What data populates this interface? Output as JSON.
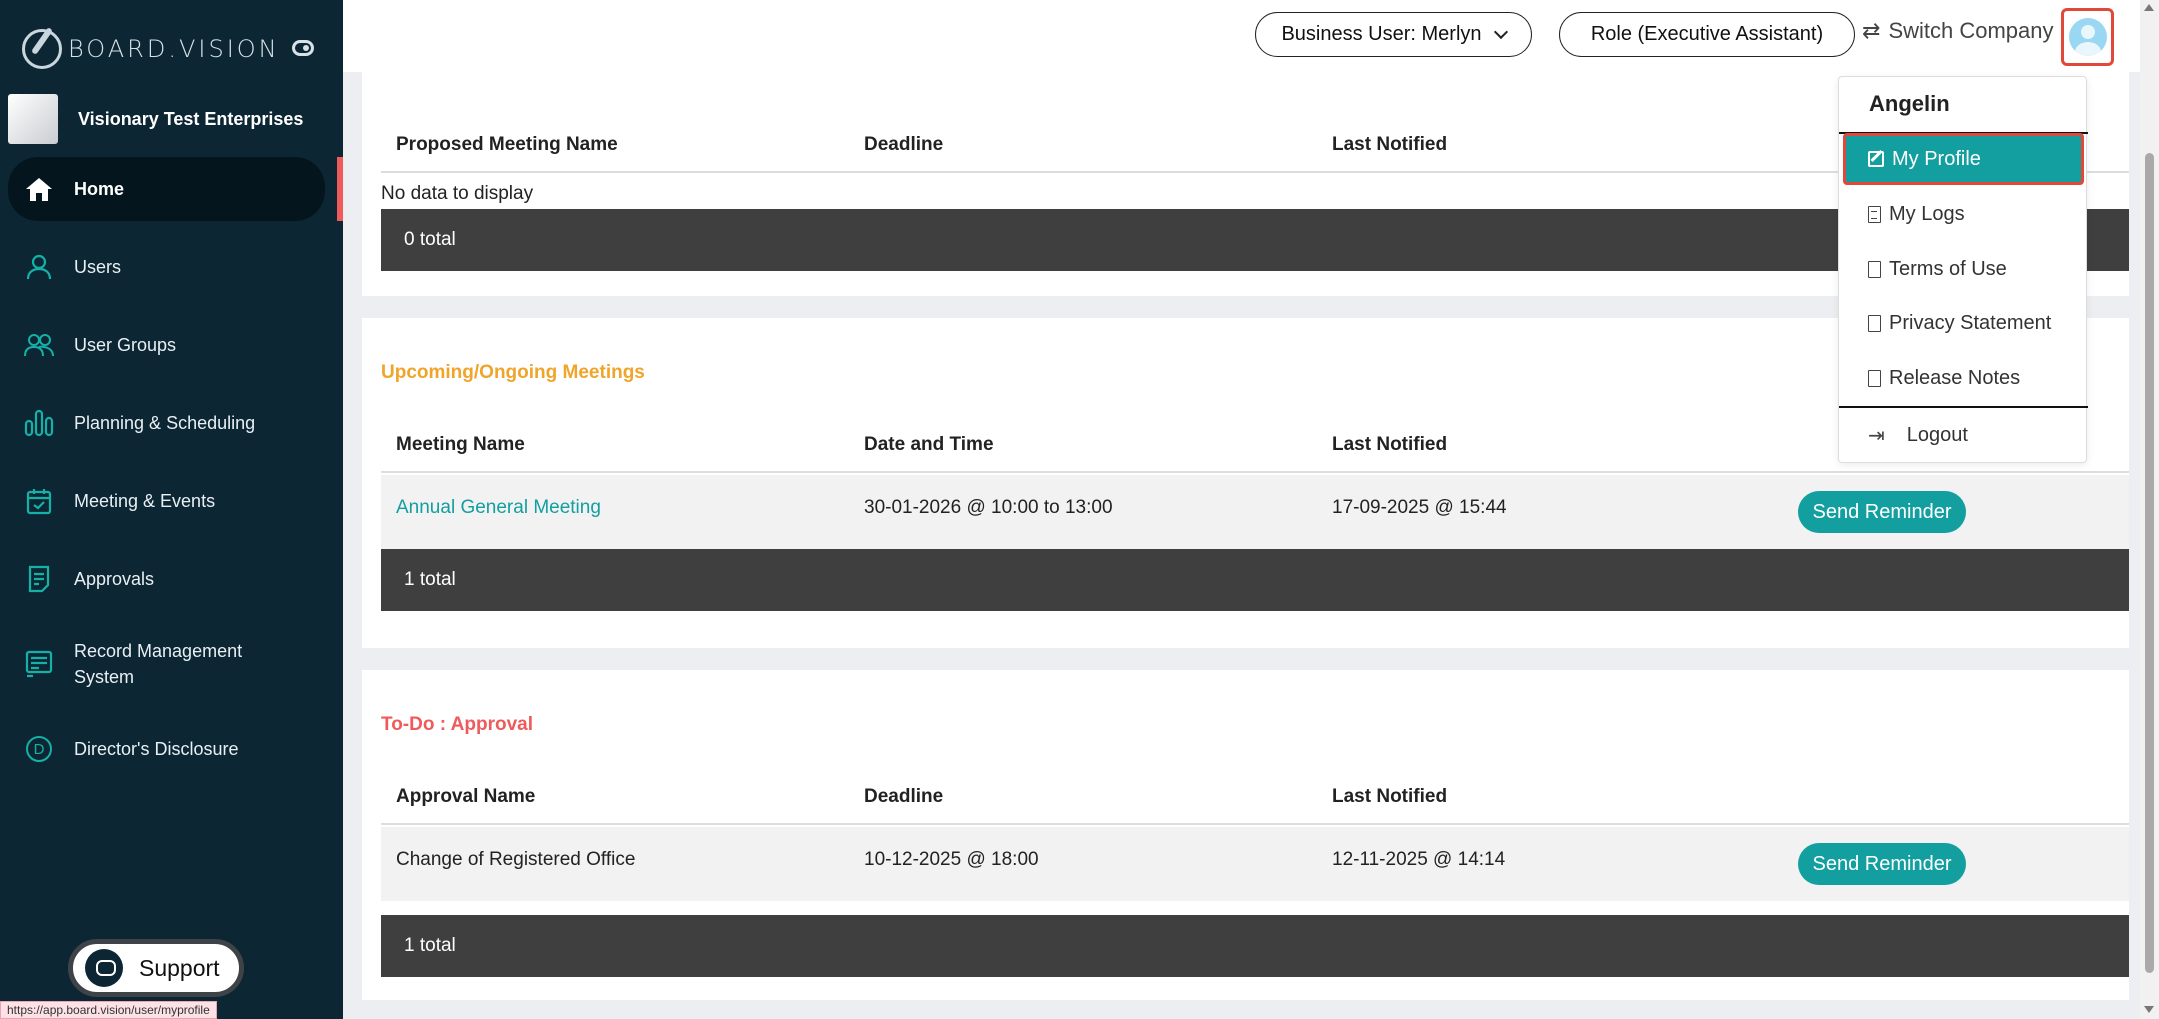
{
  "sidebar": {
    "brand": "BOARD.VISION",
    "company_name": "Visionary Test Enterprises",
    "items": [
      {
        "label": "Home",
        "icon": "home-icon"
      },
      {
        "label": "Users",
        "icon": "user-icon"
      },
      {
        "label": "User Groups",
        "icon": "users-icon"
      },
      {
        "label": "Planning & Scheduling",
        "icon": "chart-bars-icon"
      },
      {
        "label": "Meeting & Events",
        "icon": "calendar-icon"
      },
      {
        "label": "Approvals",
        "icon": "document-icon"
      },
      {
        "label": "Record Management System",
        "icon": "record-icon"
      },
      {
        "label": "Director's Disclosure",
        "icon": "d-circle-icon"
      }
    ],
    "support_label": "Support",
    "status_url": "https://app.board.vision/user/myprofile"
  },
  "topbar": {
    "business_user": "Business User: Merlyn",
    "role": "Role (Executive Assistant)",
    "switch_company": "Switch Company"
  },
  "proposed": {
    "headers": [
      "Proposed Meeting Name",
      "Deadline",
      "Last Notified"
    ],
    "empty_text": "No data to display",
    "total": "0 total"
  },
  "upcoming": {
    "title": "Upcoming/Ongoing Meetings",
    "headers": [
      "Meeting Name",
      "Date and Time",
      "Last Notified"
    ],
    "row": {
      "name": "Annual General Meeting",
      "datetime": "30-01-2026 @ 10:00 to 13:00",
      "last_notified": "17-09-2025 @ 15:44",
      "action": "Send Reminder"
    },
    "total": "1 total"
  },
  "todo": {
    "title": "To-Do : Approval",
    "headers": [
      "Approval Name",
      "Deadline",
      "Last Notified"
    ],
    "row": {
      "name": "Change of Registered Office",
      "deadline": "10-12-2025 @ 18:00",
      "last_notified": "12-11-2025 @ 14:14",
      "action": "Send Reminder"
    },
    "total": "1 total"
  },
  "profile_menu": {
    "name": "Angelin",
    "items": [
      "My Profile",
      "My Logs",
      "Terms of Use",
      "Privacy Statement",
      "Release Notes"
    ],
    "logout": "Logout"
  },
  "colors": {
    "sidebar_bg": "#0d2633",
    "accent": "#139ea0",
    "upcoming_title": "#f0a52a",
    "todo_title": "#ef5a5a",
    "highlight_border": "#e0493a"
  }
}
